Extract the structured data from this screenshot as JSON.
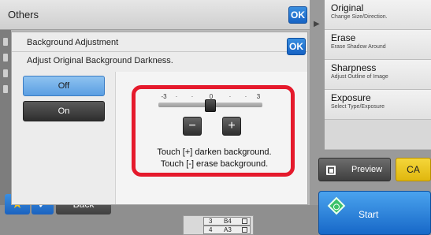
{
  "others_panel": {
    "title": "Others",
    "ok_label": "OK"
  },
  "dialog": {
    "title": "Background Adjustment",
    "subtitle": "Adjust Original Background Darkness.",
    "ok_label": "OK",
    "modes": {
      "off_label": "Off",
      "on_label": "On",
      "selected": "Off"
    },
    "scale": {
      "min_label": "-3",
      "mid_label": "0",
      "max_label": "3",
      "value": 0
    },
    "minus_label": "−",
    "plus_label": "+",
    "hint_line1": "Touch [+] darken background.",
    "hint_line2": "Touch [-] erase background."
  },
  "functions": [
    {
      "title": "Original",
      "subtitle": "Change Size/Direction."
    },
    {
      "title": "Erase",
      "subtitle": "Erase Shadow Around"
    },
    {
      "title": "Sharpness",
      "subtitle": "Adjust Outline of Image"
    },
    {
      "title": "Exposure",
      "subtitle": "Select Type/Exposure"
    }
  ],
  "actions": {
    "preview_label": "Preview",
    "ca_label": "CA",
    "start_label": "Start",
    "back_label": "Back"
  },
  "trays": [
    {
      "number": "3",
      "size": "B4"
    },
    {
      "number": "4",
      "size": "A3"
    }
  ],
  "colors": {
    "ok_blue": "#1662c4",
    "highlight_red": "#e51a2c",
    "selected_mode": "#5a9ee2",
    "ca_yellow": "#e0b70e",
    "start_blue": "#1768c8"
  }
}
